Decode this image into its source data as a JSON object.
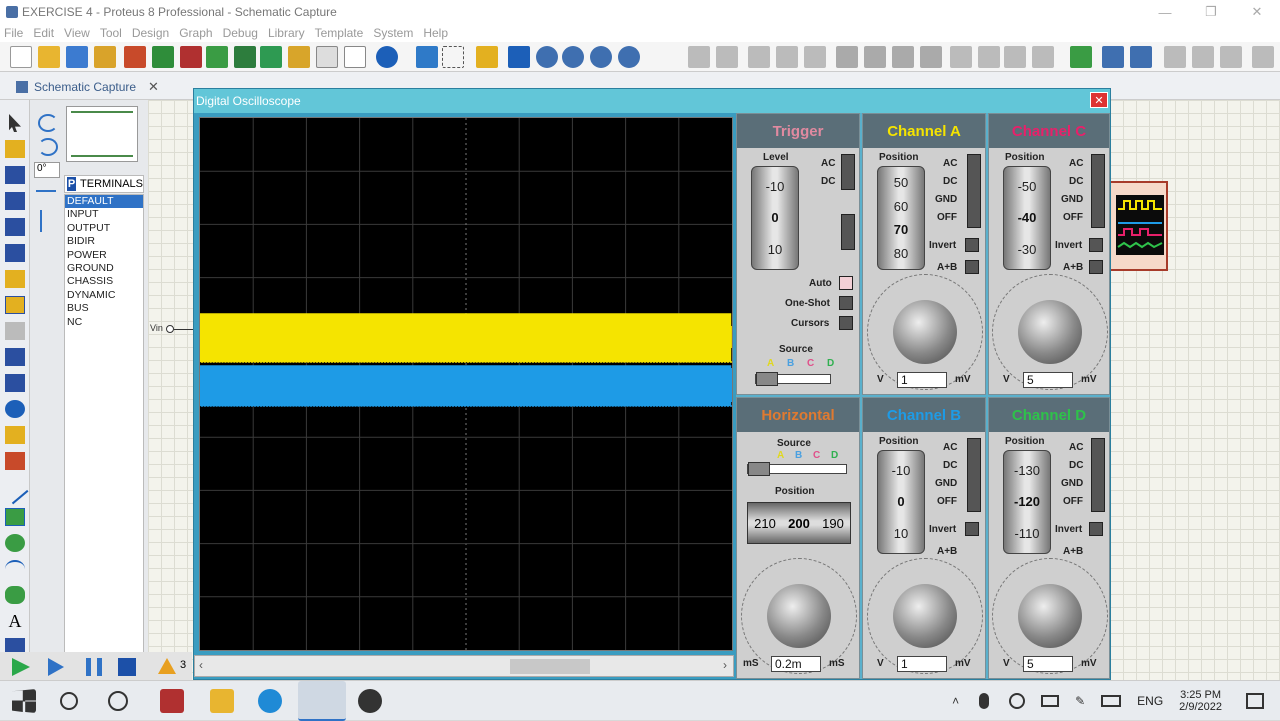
{
  "window": {
    "title": "EXERCISE 4 - Proteus 8 Professional - Schematic Capture"
  },
  "menu": [
    "File",
    "Edit",
    "View",
    "Tool",
    "Design",
    "Graph",
    "Debug",
    "Library",
    "Template",
    "System",
    "Help"
  ],
  "tab": {
    "label": "Schematic Capture"
  },
  "object_selector": {
    "header": "TERMINALS",
    "rotation": "0°",
    "items": [
      "DEFAULT",
      "INPUT",
      "OUTPUT",
      "BIDIR",
      "POWER",
      "GROUND",
      "CHASSIS",
      "DYNAMIC",
      "BUS",
      "NC"
    ],
    "selected": "DEFAULT"
  },
  "schematic": {
    "terminal_label": "Vin"
  },
  "oscilloscope": {
    "title": "Digital Oscilloscope",
    "trigger": {
      "title": "Trigger",
      "level_label": "Level",
      "level_values": [
        "-10",
        "0",
        "10"
      ],
      "ac": "AC",
      "dc": "DC",
      "auto": "Auto",
      "one_shot": "One-Shot",
      "cursors": "Cursors",
      "source_label": "Source",
      "sources": [
        "A",
        "B",
        "C",
        "D"
      ]
    },
    "horizontal": {
      "title": "Horizontal",
      "source_label": "Source",
      "sources": [
        "A",
        "B",
        "C",
        "D"
      ],
      "position_label": "Position",
      "position_values": [
        "210",
        "200",
        "190"
      ],
      "unit_left": "mS",
      "unit_right": "mS",
      "value": "0.2m"
    },
    "channels": [
      {
        "id": "A",
        "title": "Channel A",
        "color": "#f5e400",
        "position_label": "Position",
        "position_values": [
          "50",
          "60",
          "70",
          "80"
        ],
        "value": "1",
        "unit_left": "V",
        "unit_right": "mV"
      },
      {
        "id": "C",
        "title": "Channel C",
        "color": "#e8206a",
        "position_label": "Position",
        "position_values": [
          "-50",
          "-40",
          "-30"
        ],
        "value": "5",
        "unit_left": "V",
        "unit_right": "mV"
      },
      {
        "id": "B",
        "title": "Channel B",
        "color": "#1e9be6",
        "position_label": "Position",
        "position_values": [
          "-10",
          "0",
          "10"
        ],
        "value": "1",
        "unit_left": "V",
        "unit_right": "mV"
      },
      {
        "id": "D",
        "title": "Channel D",
        "color": "#2ec24a",
        "position_label": "Position",
        "position_values": [
          "-130",
          "-120",
          "-110"
        ],
        "value": "5",
        "unit_left": "V",
        "unit_right": "mV"
      }
    ],
    "coupling": [
      "AC",
      "DC",
      "GND",
      "OFF"
    ],
    "invert": "Invert",
    "apb": "A+B",
    "knob_scale": [
      "0.5",
      "0.2",
      "0.1",
      "50",
      "20",
      "10",
      "5",
      "2",
      "1"
    ],
    "time_scale": [
      "0.5",
      "0.2",
      "0.1",
      "50",
      "20",
      "10",
      "5",
      "2",
      "1",
      "200",
      "100"
    ]
  },
  "status": {
    "warning": "3"
  },
  "taskbar": {
    "time": "3:25 PM",
    "date": "2/9/2022",
    "lang": "ENG"
  },
  "colors": {
    "trace_a": "#f5e400",
    "trace_b": "#1e9be6"
  }
}
